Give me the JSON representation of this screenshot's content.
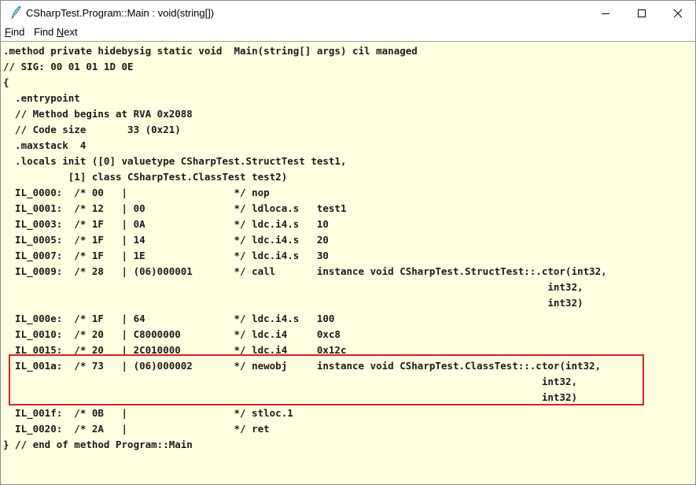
{
  "window": {
    "title": "CSharpTest.Program::Main : void(string[])",
    "icon": "ildasm-quill-icon",
    "controls": [
      "minimize-icon",
      "maximize-icon",
      "close-icon"
    ]
  },
  "menu": {
    "find": {
      "accel": "F",
      "rest": "ind"
    },
    "find_next": {
      "pre": "Find ",
      "accel": "N",
      "rest": "ext"
    }
  },
  "code_lines": [
    ".method private hidebysig static void  Main(string[] args) cil managed",
    "// SIG: 00 01 01 1D 0E",
    "{",
    "  .entrypoint",
    "  // Method begins at RVA 0x2088",
    "  // Code size       33 (0x21)",
    "  .maxstack  4",
    "  .locals init ([0] valuetype CSharpTest.StructTest test1,",
    "           [1] class CSharpTest.ClassTest test2)",
    "  IL_0000:  /* 00   |                  */ nop",
    "  IL_0001:  /* 12   | 00               */ ldloca.s   test1",
    "  IL_0003:  /* 1F   | 0A               */ ldc.i4.s   10",
    "  IL_0005:  /* 1F   | 14               */ ldc.i4.s   20",
    "  IL_0007:  /* 1F   | 1E               */ ldc.i4.s   30",
    "  IL_0009:  /* 28   | (06)000001       */ call       instance void CSharpTest.StructTest::.ctor(int32,",
    "                                                                                            int32,",
    "                                                                                            int32)",
    "  IL_000e:  /* 1F   | 64               */ ldc.i4.s   100",
    "  IL_0010:  /* 20   | C8000000         */ ldc.i4     0xc8",
    "  IL_0015:  /* 20   | 2C010000         */ ldc.i4     0x12c",
    "  IL_001a:  /* 73   | (06)000002       */ newobj     instance void CSharpTest.ClassTest::.ctor(int32,",
    "                                                                                           int32,",
    "                                                                                           int32)",
    "  IL_001f:  /* 0B   |                  */ stloc.1",
    "  IL_0020:  /* 2A   |                  */ ret",
    "} // end of method Program::Main"
  ],
  "colors": {
    "content_bg": "#ffffe1",
    "highlight_border": "#e02020"
  }
}
